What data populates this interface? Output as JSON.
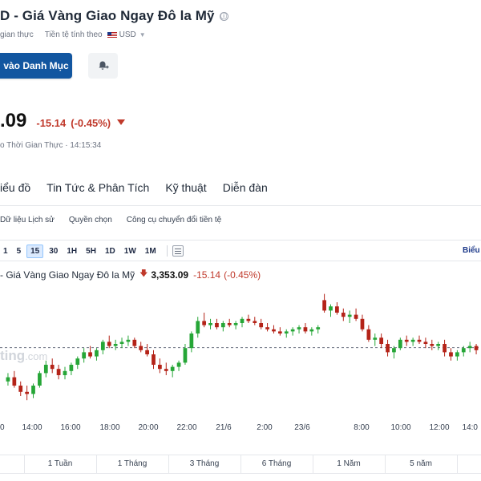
{
  "header": {
    "title": "D - Giá Vàng Giao Ngay Đô la Mỹ",
    "info_icon": "ⓘ",
    "realtime_label": "gian thực",
    "currency_label": "Tiền tệ tính theo",
    "currency_value": "USD"
  },
  "actions": {
    "portfolio_label": "vào Danh Mục",
    "alert_icon": "bell-plus-icon"
  },
  "quote": {
    "price": ".09",
    "change": "-15.14",
    "change_pct": "(-0.45%)",
    "time_label": "o Thời Gian Thực · 14:15:34"
  },
  "main_tabs": [
    "iểu đồ",
    "Tin Tức & Phân Tích",
    "Kỹ thuật",
    "Diễn đàn"
  ],
  "sub_tabs": [
    "Dữ liệu Lịch sử",
    "Quyền chọn",
    "Công cụ chuyển đổi tiền tệ"
  ],
  "toolbar": {
    "timeframes": [
      "1",
      "5",
      "15",
      "30",
      "1H",
      "5H",
      "1D",
      "1W",
      "1M"
    ],
    "active_timeframe": "15",
    "right_label": "Biểu"
  },
  "legend": {
    "name": "- Giá Vàng Giao Ngay Đô la Mỹ",
    "arrow": "🡇",
    "price": "3,353.09",
    "change": "-15.14",
    "change_pct": "(-0.45%)"
  },
  "watermark": {
    "text": "ting",
    "suffix": ".com"
  },
  "chart_data": {
    "type": "candlestick",
    "x_ticks": [
      "0",
      "14:00",
      "16:00",
      "18:00",
      "20:00",
      "22:00",
      "21/6",
      "2:00",
      "23/6",
      "8:00",
      "10:00",
      "12:00",
      "14:0"
    ],
    "reference_price": 3368.2,
    "ylim": [
      3335,
      3395
    ],
    "colors": {
      "up": "#26a637",
      "down": "#b42318",
      "reference_line": "#6b7280"
    },
    "candles": [
      [
        3352,
        3356,
        3350,
        3354
      ],
      [
        3354,
        3357,
        3349,
        3350
      ],
      [
        3350,
        3352,
        3345,
        3347
      ],
      [
        3347,
        3350,
        3343,
        3346
      ],
      [
        3346,
        3351,
        3344,
        3350
      ],
      [
        3350,
        3357,
        3349,
        3356
      ],
      [
        3356,
        3362,
        3354,
        3360
      ],
      [
        3360,
        3363,
        3356,
        3358
      ],
      [
        3358,
        3360,
        3353,
        3355
      ],
      [
        3355,
        3359,
        3353,
        3357
      ],
      [
        3357,
        3361,
        3355,
        3360
      ],
      [
        3360,
        3364,
        3358,
        3363
      ],
      [
        3363,
        3368,
        3361,
        3366
      ],
      [
        3366,
        3369,
        3363,
        3364
      ],
      [
        3364,
        3368,
        3362,
        3367
      ],
      [
        3367,
        3372,
        3365,
        3371
      ],
      [
        3371,
        3374,
        3368,
        3369
      ],
      [
        3369,
        3372,
        3367,
        3370
      ],
      [
        3370,
        3373,
        3368,
        3371
      ],
      [
        3371,
        3374,
        3369,
        3372
      ],
      [
        3372,
        3373,
        3368,
        3369
      ],
      [
        3369,
        3371,
        3366,
        3367
      ],
      [
        3367,
        3370,
        3364,
        3365
      ],
      [
        3365,
        3367,
        3358,
        3360
      ],
      [
        3360,
        3363,
        3356,
        3358
      ],
      [
        3358,
        3361,
        3355,
        3357
      ],
      [
        3357,
        3360,
        3354,
        3359
      ],
      [
        3359,
        3362,
        3357,
        3361
      ],
      [
        3361,
        3370,
        3360,
        3368
      ],
      [
        3368,
        3376,
        3366,
        3375
      ],
      [
        3375,
        3383,
        3373,
        3381
      ],
      [
        3381,
        3385,
        3378,
        3379
      ],
      [
        3379,
        3382,
        3377,
        3380
      ],
      [
        3380,
        3382,
        3377,
        3378
      ],
      [
        3378,
        3381,
        3376,
        3380
      ],
      [
        3380,
        3382,
        3378,
        3379
      ],
      [
        3379,
        3381,
        3377,
        3380
      ],
      [
        3380,
        3383,
        3378,
        3382
      ],
      [
        3382,
        3384,
        3380,
        3381
      ],
      [
        3381,
        3383,
        3379,
        3380
      ],
      [
        3380,
        3382,
        3377,
        3378
      ],
      [
        3378,
        3380,
        3376,
        3377
      ],
      [
        3377,
        3379,
        3375,
        3376
      ],
      [
        3376,
        3378,
        3374,
        3375
      ],
      [
        3375,
        3377,
        3373,
        3376
      ],
      [
        3376,
        3378,
        3374,
        3377
      ],
      [
        3377,
        3379,
        3375,
        3378
      ],
      [
        3378,
        3380,
        3375,
        3376
      ],
      [
        3376,
        3378,
        3374,
        3377
      ],
      [
        3377,
        3379,
        3375,
        3378
      ],
      [
        3391,
        3394,
        3385,
        3386
      ],
      [
        3386,
        3389,
        3383,
        3388
      ],
      [
        3388,
        3390,
        3384,
        3385
      ],
      [
        3385,
        3387,
        3381,
        3383
      ],
      [
        3383,
        3386,
        3380,
        3384
      ],
      [
        3384,
        3387,
        3381,
        3382
      ],
      [
        3382,
        3384,
        3376,
        3377
      ],
      [
        3377,
        3379,
        3371,
        3372
      ],
      [
        3372,
        3375,
        3369,
        3373
      ],
      [
        3373,
        3375,
        3368,
        3370
      ],
      [
        3370,
        3372,
        3364,
        3366
      ],
      [
        3366,
        3369,
        3363,
        3368
      ],
      [
        3368,
        3373,
        3367,
        3372
      ],
      [
        3372,
        3374,
        3369,
        3371
      ],
      [
        3371,
        3373,
        3369,
        3372
      ],
      [
        3372,
        3374,
        3370,
        3371
      ],
      [
        3371,
        3373,
        3368,
        3370
      ],
      [
        3370,
        3372,
        3367,
        3369
      ],
      [
        3369,
        3371,
        3367,
        3370
      ],
      [
        3370,
        3372,
        3364,
        3366
      ],
      [
        3366,
        3368,
        3362,
        3364
      ],
      [
        3364,
        3367,
        3362,
        3366
      ],
      [
        3366,
        3369,
        3364,
        3368
      ],
      [
        3368,
        3371,
        3366,
        3369
      ],
      [
        3369,
        3370,
        3365,
        3367
      ]
    ]
  },
  "range_bar": [
    "1 Tuần",
    "1 Tháng",
    "3 Tháng",
    "6 Tháng",
    "1 Năm",
    "5 năm"
  ]
}
